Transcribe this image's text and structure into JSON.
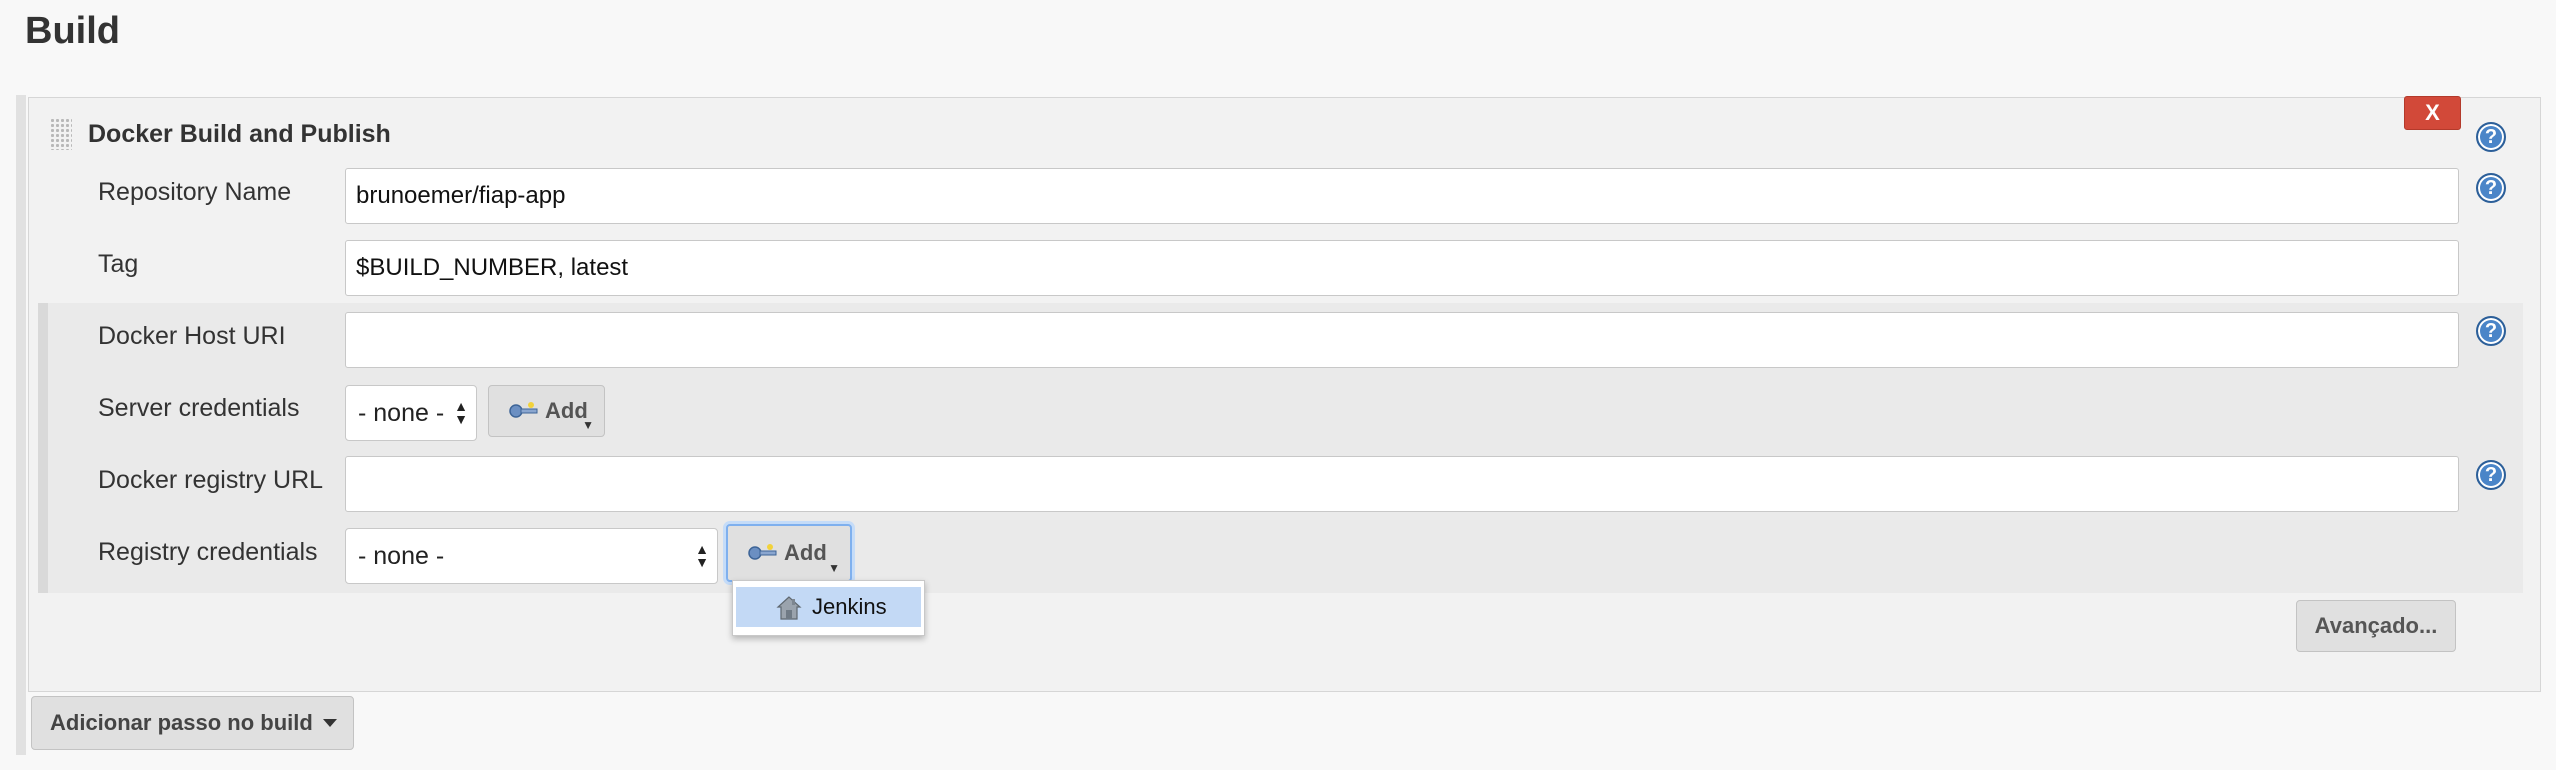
{
  "page": {
    "title": "Build"
  },
  "step": {
    "title": "Docker Build and Publish",
    "delete_label": "X",
    "help_glyph": "?"
  },
  "fields": {
    "repository": {
      "label": "Repository Name",
      "value": "brunoemer/fiap-app"
    },
    "tag": {
      "label": "Tag",
      "value": "$BUILD_NUMBER, latest"
    },
    "docker_host": {
      "label": "Docker Host URI",
      "value": ""
    },
    "server_credentials": {
      "label": "Server credentials",
      "selected": "- none -",
      "add_label": "Add"
    },
    "registry_url": {
      "label": "Docker registry URL",
      "value": ""
    },
    "registry_credentials": {
      "label": "Registry credentials",
      "selected": "- none -",
      "add_label": "Add"
    }
  },
  "dropdown": {
    "items": [
      {
        "label": "Jenkins",
        "icon": "house-icon"
      }
    ]
  },
  "buttons": {
    "advanced": "Avançado...",
    "add_build_step": "Adicionar passo no build"
  },
  "colors": {
    "delete": "#d24939",
    "help": "#4a85c8",
    "dropdown_highlight": "#c3d9f5"
  }
}
